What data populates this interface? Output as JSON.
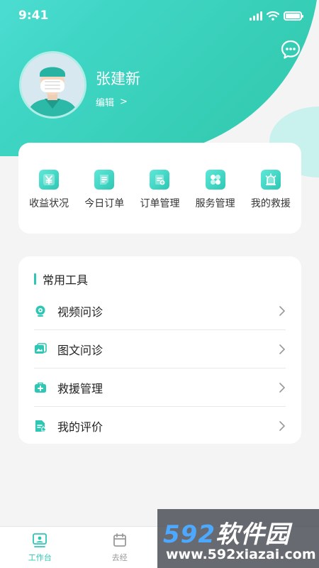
{
  "status_bar": {
    "time": "9:41"
  },
  "profile": {
    "name": "张建新",
    "edit_label": "编辑",
    "edit_chevron": ">"
  },
  "quick_actions": [
    {
      "label": "收益状况",
      "icon": "yen-icon"
    },
    {
      "label": "今日订单",
      "icon": "document-icon"
    },
    {
      "label": "订单管理",
      "icon": "clipboard-gear-icon"
    },
    {
      "label": "服务管理",
      "icon": "grid-icon"
    },
    {
      "label": "我的救援",
      "icon": "siren-icon"
    }
  ],
  "tools": {
    "title": "常用工具",
    "items": [
      {
        "label": "视频问诊",
        "icon": "webcam-icon"
      },
      {
        "label": "图文问诊",
        "icon": "image-text-icon"
      },
      {
        "label": "救援管理",
        "icon": "medical-kit-icon"
      },
      {
        "label": "我的评价",
        "icon": "edit-document-icon"
      }
    ]
  },
  "tabbar": {
    "tabs": [
      {
        "label": "工作台",
        "icon": "workbench-icon",
        "active": true
      },
      {
        "label": "去经",
        "icon": "calendar-icon",
        "active": false
      }
    ]
  },
  "watermark": {
    "brand_num": "592",
    "brand_text": "软件园",
    "url": "www.592xiazai.com"
  },
  "colors": {
    "accent": "#2ec7b4",
    "hero_start": "#5ee8e4",
    "hero_end": "#2fc7a9"
  }
}
